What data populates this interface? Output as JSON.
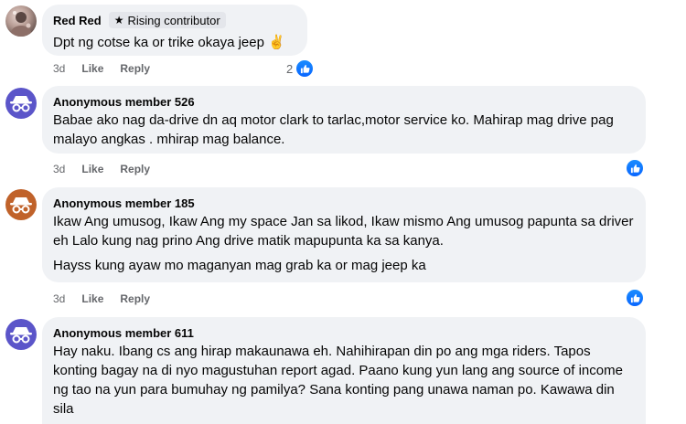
{
  "comments": [
    {
      "author": "Red Red",
      "badge": "Rising contributor",
      "paragraphs": [
        "Dpt ng cotse ka or trike okaya jeep ✌️"
      ],
      "time": "3d",
      "like_label": "Like",
      "reply_label": "Reply",
      "reaction_count": "2",
      "avatar_icon": "profile-photo"
    },
    {
      "author": "Anonymous member 526",
      "paragraphs": [
        "Babae ako nag da-drive dn aq motor clark to tarlac,motor service ko. Mahirap mag drive pag malayo angkas . mhirap mag balance."
      ],
      "time": "3d",
      "like_label": "Like",
      "reply_label": "Reply",
      "avatar_icon": "incognito-icon",
      "avatar_color": "#5b55c9"
    },
    {
      "author": "Anonymous member 185",
      "paragraphs": [
        "Ikaw Ang umusog, Ikaw Ang my space Jan sa likod, Ikaw mismo Ang umusog papunta sa driver eh Lalo kung nag prino Ang drive matik mapupunta ka sa kanya.",
        "Hayss kung ayaw mo maganyan mag grab ka or mag jeep ka"
      ],
      "time": "3d",
      "like_label": "Like",
      "reply_label": "Reply",
      "avatar_icon": "incognito-icon",
      "avatar_color": "#c0622a"
    },
    {
      "author": "Anonymous member 611",
      "paragraphs": [
        "Hay naku. Ibang cs ang hirap makaunawa eh. Nahihirapan din po ang mga riders. Tapos konting bagay na di nyo magustuhan report agad. Paano kung yun lang ang source of income ng tao na yun para bumuhay ng pamilya? Sana konting pang unawa naman po. Kawawa din sila"
      ],
      "avatar_icon": "incognito-icon",
      "avatar_color": "#5b55c9"
    }
  ],
  "colors": {
    "bubble": "#f0f2f5",
    "like_blue": "#0866ff",
    "meta_gray": "#65676b"
  }
}
